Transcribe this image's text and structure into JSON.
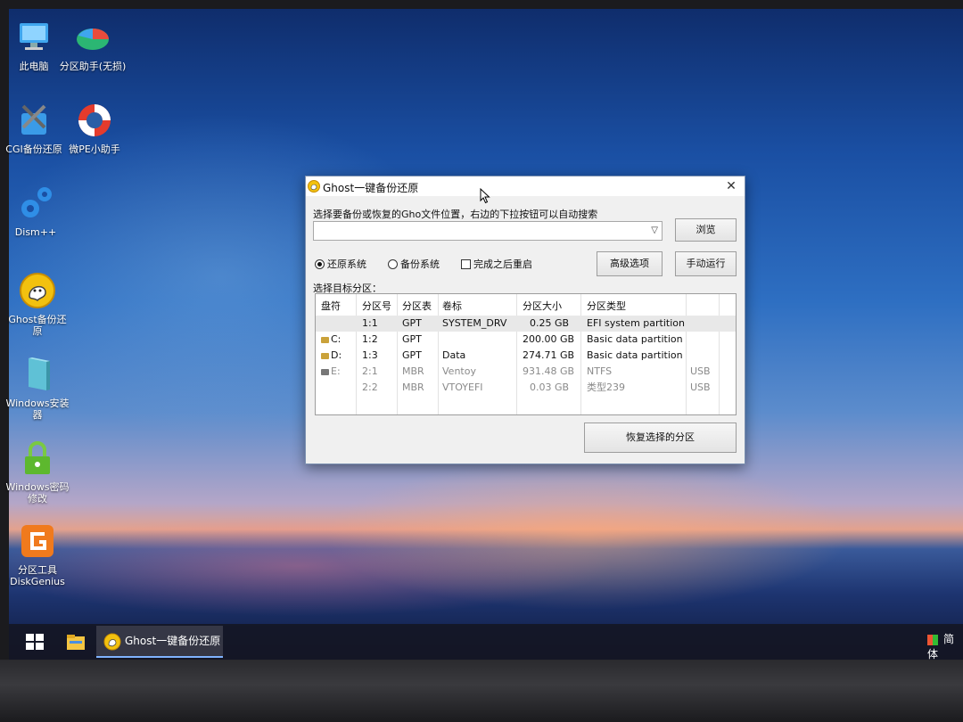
{
  "desktop": {
    "icons": [
      {
        "label": "此电脑",
        "icon": "computer-icon"
      },
      {
        "label": "分区助手(无损)",
        "icon": "partition-assistant-icon"
      },
      {
        "label": "CGI备份还原",
        "icon": "cgi-backup-icon"
      },
      {
        "label": "微PE小助手",
        "icon": "lifebuoy-icon"
      },
      {
        "label": "Dism++",
        "icon": "gears-icon"
      },
      {
        "label": "Ghost备份还原",
        "icon": "ghost-icon"
      },
      {
        "label": "Windows安装器",
        "icon": "windows-installer-icon"
      },
      {
        "label": "Windows密码修改",
        "icon": "lock-icon"
      },
      {
        "label": "分区工具DiskGenius",
        "icon": "diskgenius-icon"
      }
    ]
  },
  "dialog": {
    "title": "Ghost一键备份还原",
    "close_label": "✕",
    "prompt": "选择要备份或恢复的Gho文件位置，右边的下拉按钮可以自动搜索",
    "path_value": "",
    "browse_label": "浏览",
    "radio_restore": "还原系统",
    "radio_backup": "备份系统",
    "check_reboot": "完成之后重启",
    "advanced_label": "高级选项",
    "manual_label": "手动运行",
    "target_label": "选择目标分区：",
    "restore_button": "恢复选择的分区",
    "table": {
      "headers": [
        "盘符",
        "分区号",
        "分区表",
        "卷标",
        "分区大小",
        "分区类型",
        ""
      ],
      "rows": [
        {
          "drive": "",
          "num": "1:1",
          "table": "GPT",
          "label": "SYSTEM_DRV",
          "size": "0.25 GB",
          "type": "EFI system partition",
          "bus": ""
        },
        {
          "drive": "C:",
          "num": "1:2",
          "table": "GPT",
          "label": "",
          "size": "200.00 GB",
          "type": "Basic data partition",
          "bus": ""
        },
        {
          "drive": "D:",
          "num": "1:3",
          "table": "GPT",
          "label": "Data",
          "size": "274.71 GB",
          "type": "Basic data partition",
          "bus": ""
        },
        {
          "drive": "E:",
          "num": "2:1",
          "table": "MBR",
          "label": "Ventoy",
          "size": "931.48 GB",
          "type": "NTFS",
          "bus": "USB"
        },
        {
          "drive": "",
          "num": "2:2",
          "table": "MBR",
          "label": "VTOYEFI",
          "size": "0.03 GB",
          "type": "类型239",
          "bus": "USB"
        }
      ]
    }
  },
  "taskbar": {
    "task_label": "Ghost一键备份还原",
    "tray_text": "简体"
  },
  "colors": {
    "accent": "#7fb2ff",
    "ghost_yellow": "#f2c10f"
  }
}
